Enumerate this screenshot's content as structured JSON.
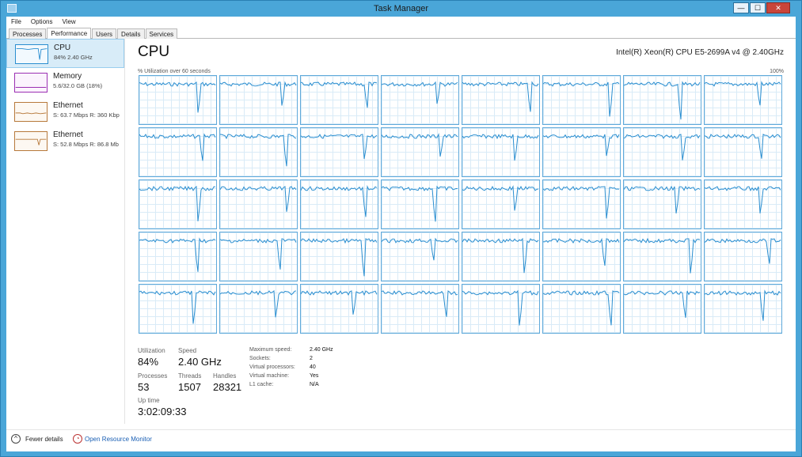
{
  "window": {
    "title": "Task Manager",
    "min": "—",
    "max": "☐",
    "close": "✕",
    "icon": "task-manager-icon"
  },
  "menu": [
    "File",
    "Options",
    "View"
  ],
  "tabs": [
    "Processes",
    "Performance",
    "Users",
    "Details",
    "Services"
  ],
  "active_tab": 1,
  "sidebar": [
    {
      "name": "CPU",
      "sub": "84% 2.40 GHz",
      "color": "#2a8ed0"
    },
    {
      "name": "Memory",
      "sub": "5.6/32.0 GB (18%)",
      "color": "#9b2fb3"
    },
    {
      "name": "Ethernet",
      "sub": "S: 63.7 Mbps R: 360 Kbp",
      "color": "#b7793b"
    },
    {
      "name": "Ethernet",
      "sub": "S: 52.8 Mbps R: 86.8 Mb",
      "color": "#b7793b"
    }
  ],
  "main": {
    "title": "CPU",
    "model": "Intel(R) Xeon(R) CPU E5-2699A v4 @ 2.40GHz",
    "util_label": "% Utilization over 60 seconds",
    "max_label": "100%"
  },
  "cpu_grid": {
    "rows": 5,
    "cols": 8,
    "line_color": "#2a8ed0"
  },
  "stats": {
    "utilization_label": "Utilization",
    "utilization": "84%",
    "speed_label": "Speed",
    "speed": "2.40 GHz",
    "processes_label": "Processes",
    "processes": "53",
    "threads_label": "Threads",
    "threads": "1507",
    "handles_label": "Handles",
    "handles": "28321",
    "uptime_label": "Up time",
    "uptime": "3:02:09:33"
  },
  "details": [
    {
      "key": "Maximum speed:",
      "val": "2.40 GHz"
    },
    {
      "key": "Sockets:",
      "val": "2"
    },
    {
      "key": "Virtual processors:",
      "val": "40"
    },
    {
      "key": "Virtual machine:",
      "val": "Yes"
    },
    {
      "key": "L1 cache:",
      "val": "N/A"
    }
  ],
  "footer": {
    "fewer": "Fewer details",
    "fewer_icon": "chevron-up-icon",
    "resource_monitor": "Open Resource Monitor",
    "rm_icon": "resource-monitor-icon"
  }
}
